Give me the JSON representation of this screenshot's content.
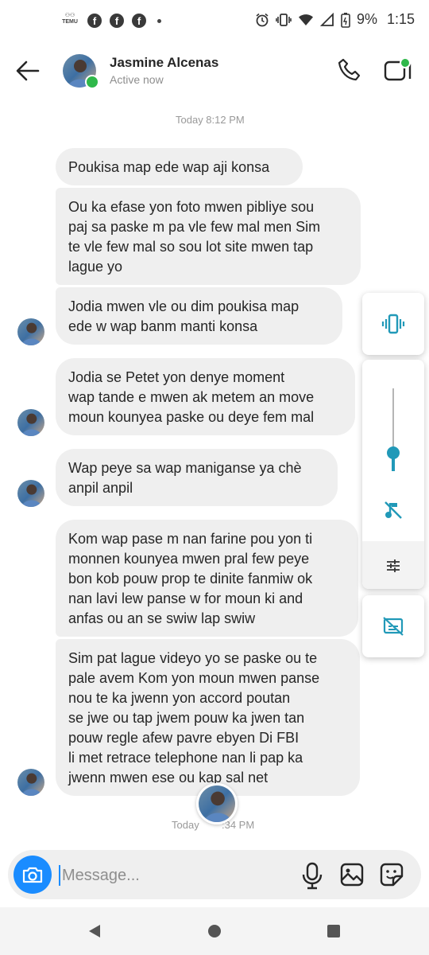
{
  "status_bar": {
    "temu_label": "TEMU",
    "battery": "9%",
    "time": "1:15"
  },
  "header": {
    "contact_name": "Jasmine Alcenas",
    "status": "Active now"
  },
  "timestamps": {
    "top": "Today 8:12 PM",
    "bottom_prefix": "Today",
    "bottom_suffix": ":34 PM"
  },
  "messages": [
    {
      "text": "Poukisa map ede wap aji konsa"
    },
    {
      "text": "Ou ka efase yon foto mwen pibliye sou\npaj sa paske m pa vle few mal men Sim\nte vle few mal so sou lot site mwen tap\nlague yo"
    },
    {
      "text": "Jodia mwen vle ou dim poukisa map\nede w wap banm manti konsa"
    },
    {
      "text": "Jodia se Petet yon denye moment\nwap tande e mwen ak metem an move\nmoun kounyea paske ou deye fem mal"
    },
    {
      "text": "Wap peye sa wap maniganse ya chè\nanpil anpil"
    },
    {
      "text": "Kom wap pase m nan farine pou yon ti\nmonnen kounyea mwen pral few peye\nbon kob pouw prop te dinite fanmiw ok\nnan lavi lew panse w for moun ki and\nanfas ou an se swiw lap swiw"
    },
    {
      "text": "Sim pat lague videyo yo se paske ou te\npale avem Kom yon moun mwen panse\nnou te ka jwenn yon accord poutan\nse jwe ou tap jwem pouw ka jwen tan\npouw regle afew pavre ebyen Di FBI\nli met retrace telephone nan li pap ka\njwenn mwen ese ou kap sal net"
    }
  ],
  "composer": {
    "placeholder": "Message..."
  },
  "volume_panel": {
    "level": 0.22
  },
  "colors": {
    "accent": "#1a8cff",
    "panel_accent": "#2199b8",
    "online": "#2fb84a",
    "bubble": "#efefef"
  },
  "icons": [
    "back-arrow-icon",
    "phone-icon",
    "video-call-icon",
    "camera-icon",
    "microphone-icon",
    "gallery-icon",
    "sticker-icon",
    "vibrate-icon",
    "mute-icon",
    "equalizer-icon",
    "captions-off-icon"
  ]
}
